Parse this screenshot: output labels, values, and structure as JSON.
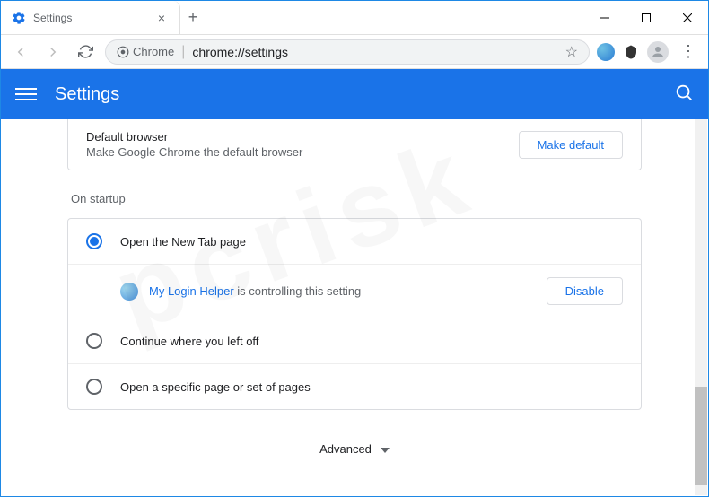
{
  "browser_tab": {
    "title": "Settings"
  },
  "omnibox": {
    "chrome_label": "Chrome",
    "url": "chrome://settings"
  },
  "header": {
    "title": "Settings"
  },
  "default_browser": {
    "title": "Default browser",
    "subtitle": "Make Google Chrome the default browser",
    "button": "Make default"
  },
  "startup": {
    "section_label": "On startup",
    "options": [
      {
        "label": "Open the New Tab page"
      },
      {
        "label": "Continue where you left off"
      },
      {
        "label": "Open a specific page or set of pages"
      }
    ],
    "controlled": {
      "extension_name": "My Login Helper",
      "suffix_text": " is controlling this setting",
      "disable_button": "Disable"
    }
  },
  "advanced_label": "Advanced"
}
